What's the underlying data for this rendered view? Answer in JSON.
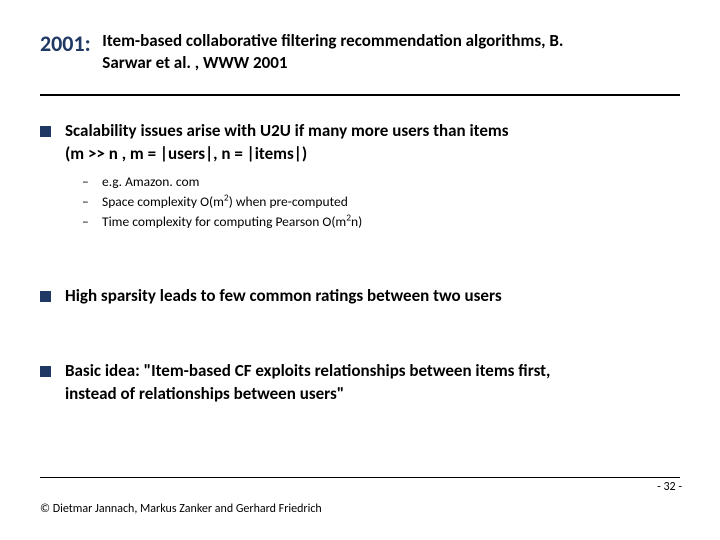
{
  "header": {
    "year": "2001:",
    "title_line1": "Item-based collaborative filtering recommendation algorithms, B.",
    "title_line2": "Sarwar et al. , WWW 2001"
  },
  "points": [
    {
      "main_line1": "Scalability issues arise with U2U if many more users than items",
      "main_line2": "(m >> n , m = |users|, n = |items|)",
      "subs": [
        "e.g. Amazon. com",
        "Space complexity O(m²) when pre-computed",
        "Time complexity for computing Pearson O(m²n)"
      ]
    },
    {
      "main_line1": "High sparsity leads to few common ratings between two users"
    },
    {
      "main_line1": "Basic idea: \"Item-based CF exploits relationships between items first,",
      "main_line2": "instead of relationships between users\""
    }
  ],
  "footer": {
    "copyright": "© Dietmar Jannach, Markus Zanker and Gerhard Friedrich",
    "pagenum": "- 32 -"
  }
}
